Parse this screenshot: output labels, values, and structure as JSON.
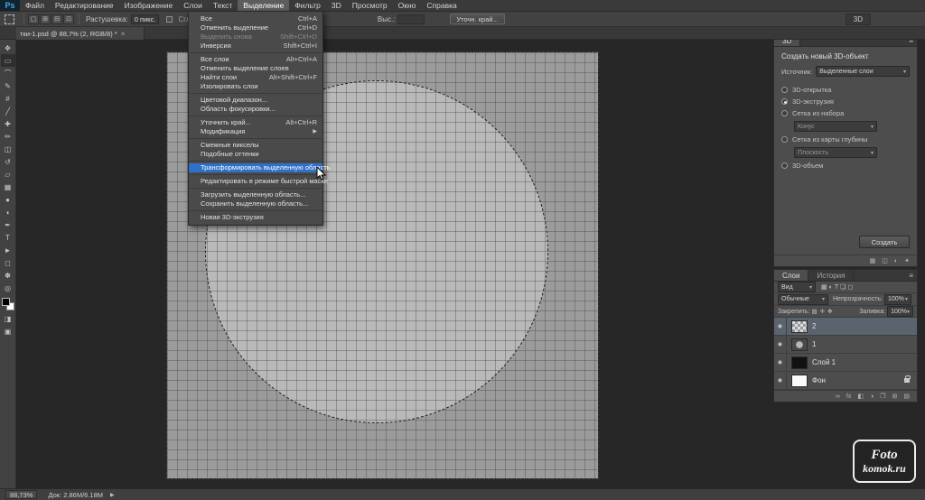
{
  "app": {
    "logo_text": "Ps",
    "workspace_label": "3D"
  },
  "glyphs": {
    "dropdown": "▾",
    "submenu": "▶",
    "panel_menu": "≡",
    "close": "×",
    "eye": "◉"
  },
  "menubar": {
    "items": [
      {
        "label": "Файл"
      },
      {
        "label": "Редактирование"
      },
      {
        "label": "Изображение"
      },
      {
        "label": "Слои"
      },
      {
        "label": "Текст"
      },
      {
        "label": "Выделение"
      },
      {
        "label": "Фильтр"
      },
      {
        "label": "3D"
      },
      {
        "label": "Просмотр"
      },
      {
        "label": "Окно"
      },
      {
        "label": "Справка"
      }
    ]
  },
  "options_bar": {
    "marquee_modes": [
      "▢",
      "⊞",
      "⊟",
      "⊡"
    ],
    "feather_label": "Растушевка:",
    "feather_value": "0 пикс.",
    "antialias_label": "Сглаживание",
    "height_label": "Выс.:",
    "height_value": "",
    "refine_edge_button": "Уточн. край..."
  },
  "document_tab": {
    "title": "тки-1.psd @ 88,7% (2, RGB/8) *"
  },
  "select_menu": {
    "items": [
      {
        "label": "Все",
        "shortcut": "Ctrl+A"
      },
      {
        "label": "Отменить выделение",
        "shortcut": "Ctrl+D"
      },
      {
        "label": "Выделить снова",
        "shortcut": "Shift+Ctrl+D"
      },
      {
        "label": "Инверсия",
        "shortcut": "Shift+Ctrl+I"
      },
      {
        "label": "Все слои",
        "shortcut": "Alt+Ctrl+A"
      },
      {
        "label": "Отменить выделение слоев",
        "shortcut": ""
      },
      {
        "label": "Найти слои",
        "shortcut": "Alt+Shift+Ctrl+F"
      },
      {
        "label": "Изолировать слои",
        "shortcut": ""
      },
      {
        "label": "Цветовой диапазон...",
        "shortcut": ""
      },
      {
        "label": "Область фокусировки...",
        "shortcut": ""
      },
      {
        "label": "Уточнить край...",
        "shortcut": "Alt+Ctrl+R"
      },
      {
        "label": "Модификация",
        "shortcut": ""
      },
      {
        "label": "Смежные пикселы",
        "shortcut": ""
      },
      {
        "label": "Подобные оттенки",
        "shortcut": ""
      },
      {
        "label": "Трансформировать выделенную область",
        "shortcut": ""
      },
      {
        "label": "Редактировать в режиме быстрой маски",
        "shortcut": ""
      },
      {
        "label": "Загрузить выделенную область...",
        "shortcut": ""
      },
      {
        "label": "Сохранить выделенную область...",
        "shortcut": ""
      },
      {
        "label": "Новая 3D-экструзия",
        "shortcut": ""
      }
    ]
  },
  "toolbar": {
    "tools": [
      {
        "glyph": "✥"
      },
      {
        "glyph": "▭"
      },
      {
        "glyph": "⌒"
      },
      {
        "glyph": "✎"
      },
      {
        "glyph": "#"
      },
      {
        "glyph": "╱"
      },
      {
        "glyph": "✚"
      },
      {
        "glyph": "✏"
      },
      {
        "glyph": "◫"
      },
      {
        "glyph": "↺"
      },
      {
        "glyph": "▱"
      },
      {
        "glyph": "▦"
      },
      {
        "glyph": "●"
      },
      {
        "glyph": "◖"
      },
      {
        "glyph": "✒"
      },
      {
        "glyph": "T"
      },
      {
        "glyph": "►"
      },
      {
        "glyph": "◻"
      },
      {
        "glyph": "✽"
      },
      {
        "glyph": "◎"
      }
    ],
    "quick_mask_glyph": "◨",
    "screen_mode_glyph": "▣"
  },
  "panel_3d": {
    "tab": "3D",
    "title": "Создать новый 3D-объект",
    "source_label": "Источник:",
    "source_value": "Выделенные слои",
    "options": [
      {
        "label": "3D-открытка"
      },
      {
        "label": "3D-экструзия"
      },
      {
        "label": "Сетка из набора"
      },
      {
        "label": "Сетка из карты глубины"
      },
      {
        "label": "3D-объем"
      }
    ],
    "preset_value": "Конус",
    "depthmap_value": "Плоскость",
    "create_button": "Создать",
    "footer_icons": [
      "▦",
      "◫",
      "◐",
      "✦"
    ]
  },
  "panel_layers": {
    "tabs": [
      {
        "label": "Слои"
      },
      {
        "label": "История"
      }
    ],
    "filter_value": "Вид",
    "filter_icons": [
      "▦",
      "◐",
      "T",
      "❏",
      "◻"
    ],
    "blend_value": "Обычные",
    "opacity_label": "Непрозрачность:",
    "opacity_value": "100%",
    "lock_label": "Закрепить:",
    "lock_icons": [
      "▨",
      "✛",
      "✥"
    ],
    "fill_label": "Заливка:",
    "fill_value": "100%",
    "layers": [
      {
        "name": "2"
      },
      {
        "name": "1"
      },
      {
        "name": "Слой 1"
      },
      {
        "name": "Фон"
      }
    ],
    "footer_icons": [
      "∞",
      "fx",
      "◧",
      "◑",
      "❐",
      "⊞",
      "▤"
    ]
  },
  "status_bar": {
    "zoom": "88,73%",
    "doc_info": "Док: 2.86M/6.18M",
    "arrow_glyph": "▶"
  },
  "watermark": {
    "line1": "Foto",
    "line2": "komok.ru"
  },
  "colors": {
    "accent_blue": "#2f71c8",
    "canvas_bg": "#272727",
    "panel_bg": "#4d4d4d"
  }
}
